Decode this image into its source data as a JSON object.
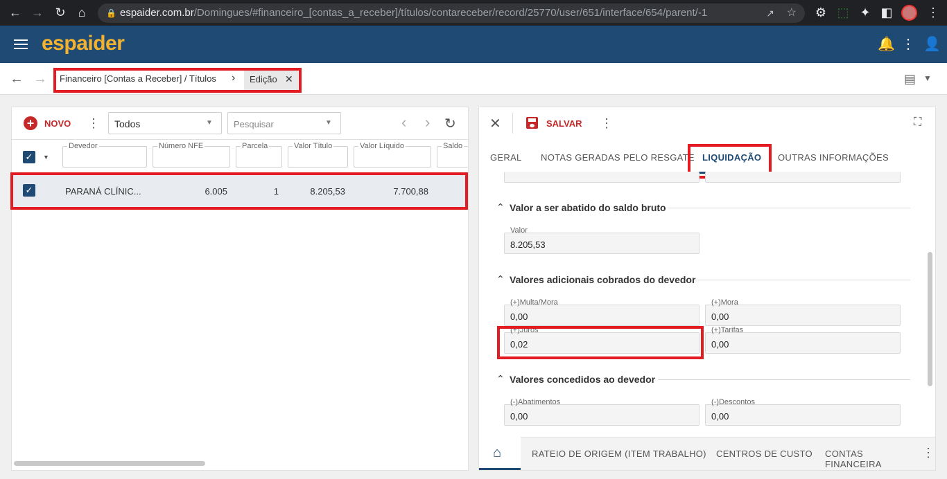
{
  "browser": {
    "url_domain": "espaider.com.br",
    "url_path": "/Domingues/#financeiro_[contas_a_receber]/títulos/contareceber/record/25770/user/651/interface/654/parent/-1"
  },
  "app": {
    "logo": "espaider"
  },
  "toolbar": {
    "breadcrumb": "Financeiro [Contas a Receber] / Títulos",
    "tab_label": "Edição"
  },
  "list": {
    "new_label": "NOVO",
    "filter_value": "Todos",
    "search_placeholder": "Pesquisar",
    "columns": [
      "Devedor",
      "Número NFE",
      "Parcela",
      "Valor Título",
      "Valor Líquido",
      "Saldo"
    ],
    "rows": [
      {
        "devedor": "PARANÁ CLÍNIC...",
        "numero_nfe": "6.005",
        "parcela": "1",
        "valor_titulo": "8.205,53",
        "valor_liquido": "7.700,88",
        "checked": true
      }
    ]
  },
  "detail": {
    "save_label": "SALVAR",
    "tabs": [
      "GERAL",
      "NOTAS GERADAS PELO RESGATE",
      "LIQUIDAÇÃO",
      "OUTRAS INFORMAÇÕES"
    ],
    "active_tab": "LIQUIDAÇÃO",
    "sections": {
      "abatido": {
        "title": "Valor a ser abatido do saldo bruto",
        "valor_label": "Valor",
        "valor": "8.205,53"
      },
      "adicionais": {
        "title": "Valores adicionais cobrados do devedor",
        "multa_label": "(+)Multa/Mora",
        "multa": "0,00",
        "mora_label": "(+)Mora",
        "mora": "0,00",
        "juros_label": "(+)Juros",
        "juros": "0,02",
        "tarifas_label": "(+)Tarifas",
        "tarifas": "0,00"
      },
      "concedidos": {
        "title": "Valores concedidos ao devedor",
        "abatimentos_label": "(-)Abatimentos",
        "abatimentos": "0,00",
        "descontos_label": "(-)Descontos",
        "descontos": "0,00"
      }
    },
    "bottom_tabs": [
      "RATEIO DE ORIGEM (ITEM TRABALHO)",
      "CENTROS DE CUSTO",
      "CONTAS FINANCEIRA"
    ]
  },
  "colors": {
    "header": "#1e4a74",
    "logo": "#f2b230",
    "accent_red": "#c62828",
    "highlight_box": "#e31b23",
    "checkbox": "#1e4a74"
  }
}
